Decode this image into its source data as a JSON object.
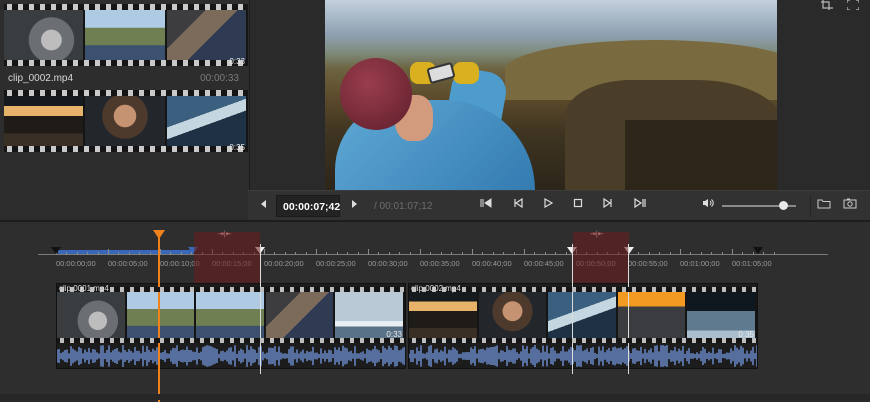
{
  "library": {
    "clips": [
      {
        "name": "",
        "duration": "",
        "badge": "0:33",
        "frames": [
          "f-grey",
          "f-sky",
          "f-crowd"
        ]
      },
      {
        "name": "clip_0002.mp4",
        "duration": "00:00:33",
        "badge": "0:35",
        "frames": [
          "f-ship",
          "f-man",
          "f-sea"
        ]
      }
    ]
  },
  "preview": {
    "corner_buttons": [
      "crop-icon",
      "fullscreen-icon"
    ]
  },
  "transport": {
    "current_time": "00:00:07;42",
    "total_time": "/ 00:01:07;12",
    "volume_level": 0.82,
    "icons": [
      "prev-frame-icon",
      "next-frame-icon",
      "go-to-start-icon",
      "step-back-icon",
      "play-icon",
      "stop-icon",
      "step-forward-icon",
      "go-to-end-icon",
      "volume-icon",
      "folder-icon",
      "snapshot-icon"
    ]
  },
  "timeline": {
    "ruler_labels": [
      "00:00:00;00",
      "00:00:05;00",
      "00:00:10;00",
      "00:00:15;00",
      "00:00:20;00",
      "00:00:25;00",
      "00:00:30;00",
      "00:00:35;00",
      "00:00:40;00",
      "00:00:45;00",
      "00:00:50;00",
      "00:00:55;00",
      "00:01:00;00",
      "00:01:05;00"
    ],
    "clips": [
      {
        "name": "clip 0001.mp4",
        "end_badge": "0:33"
      },
      {
        "name": "clip 0002.mp4",
        "end_badge": "0:35"
      }
    ],
    "playhead_time": "00:00:07;42"
  },
  "colors": {
    "playhead": "#f0821e",
    "selection": "#3a68b8",
    "cut_region": "#6e1e1e",
    "waveform": "#6f93d6"
  }
}
